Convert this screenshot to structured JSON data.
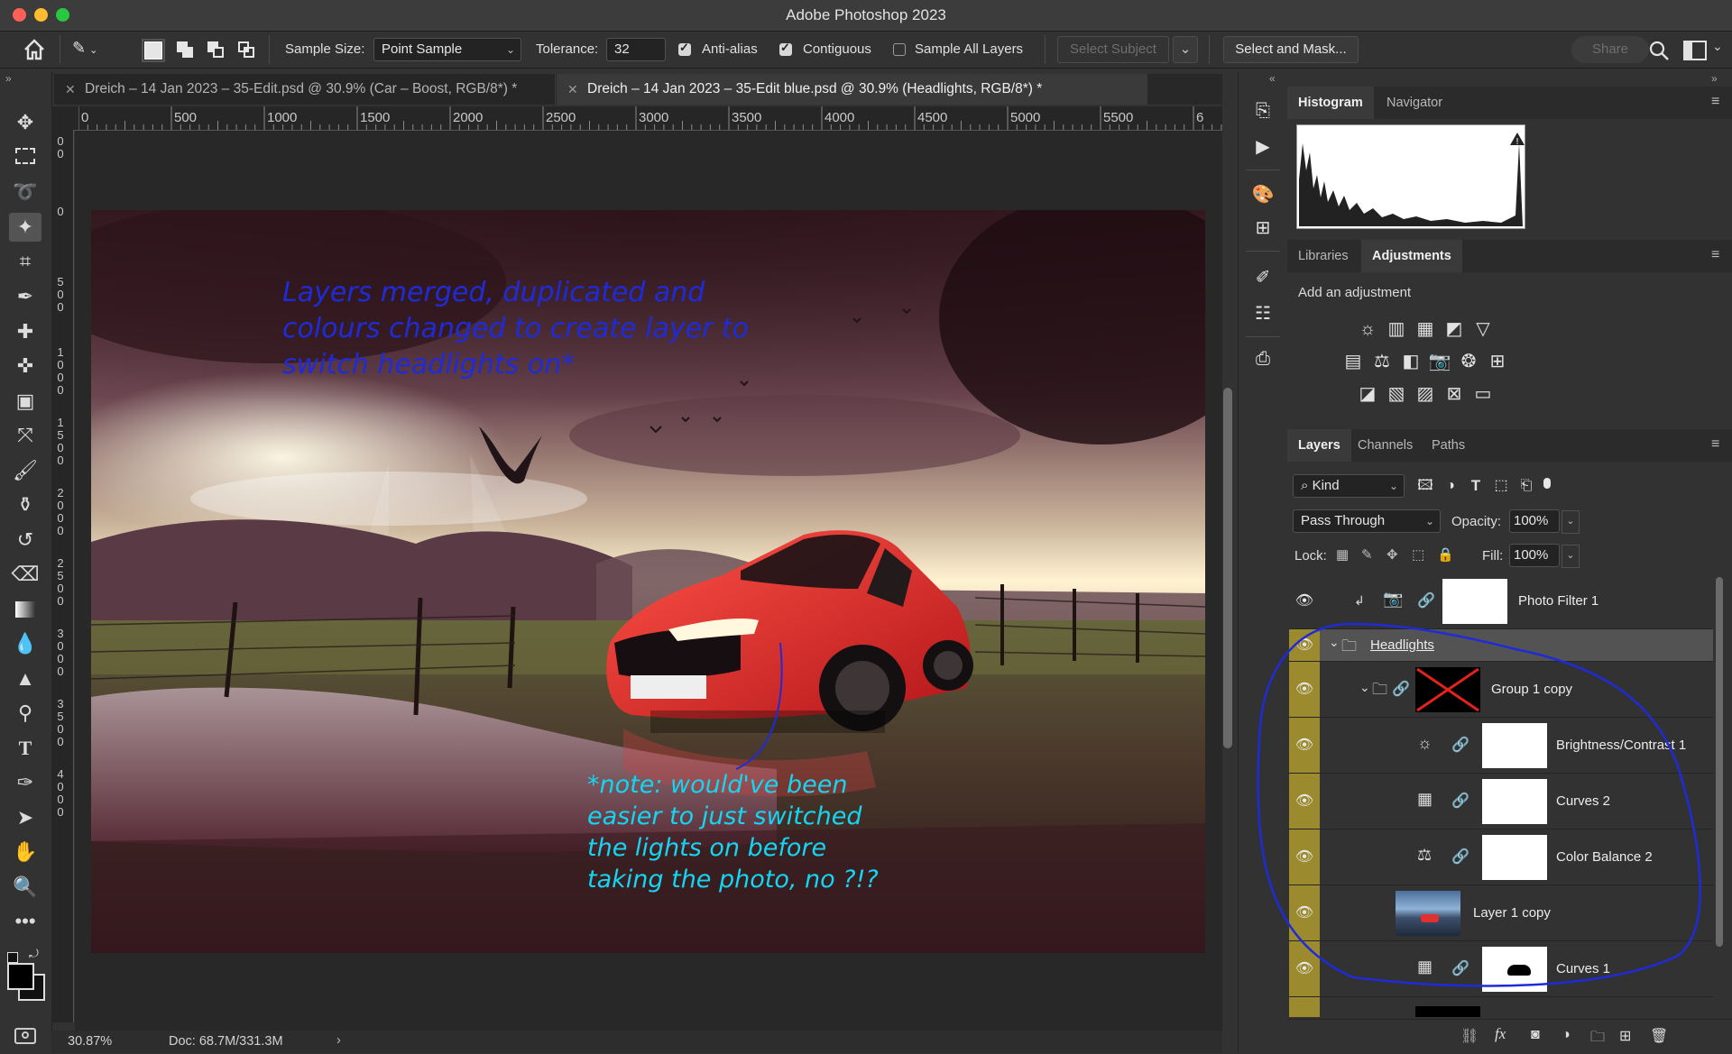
{
  "window": {
    "title": "Adobe Photoshop 2023"
  },
  "options_bar": {
    "sample_size_label": "Sample Size:",
    "sample_size_value": "Point Sample",
    "tolerance_label": "Tolerance:",
    "tolerance_value": "32",
    "anti_alias_label": "Anti-alias",
    "contiguous_label": "Contiguous",
    "sample_all_layers_label": "Sample All Layers",
    "select_subject_label": "Select Subject",
    "select_and_mask_label": "Select and Mask...",
    "share_label": "Share",
    "anti_alias_checked": true,
    "contiguous_checked": true,
    "sample_all_layers_checked": false
  },
  "tabs": [
    {
      "label": "Dreich – 14 Jan 2023 – 35-Edit.psd @ 30.9% (Car – Boost, RGB/8*) *",
      "active": false
    },
    {
      "label": "Dreich – 14 Jan 2023 – 35-Edit blue.psd @ 30.9% (Headlights, RGB/8*) *",
      "active": true
    }
  ],
  "ruler_h": [
    "0",
    "500",
    "1000",
    "1500",
    "2000",
    "2500",
    "3000",
    "3500",
    "4000",
    "4500",
    "5000",
    "5500",
    "6"
  ],
  "ruler_v": [
    "0 0",
    "0",
    "5 0 0",
    "1 0 0 0",
    "1 5 0 0",
    "2 0 0 0",
    "2 5 0 0",
    "3 0 0 0",
    "3 5 0 0",
    "4 0 0 0"
  ],
  "annotations": {
    "blue_note": [
      "Layers merged, duplicated and",
      "colours changed to create layer to",
      "switch headlights on*"
    ],
    "cyan_note": [
      "*note: would've been",
      "easier to just switched",
      "the lights on before",
      "taking the photo, no ?!?"
    ]
  },
  "status": {
    "zoom": "30.87%",
    "doc": "Doc: 68.7M/331.3M"
  },
  "panels": {
    "top_tabs": [
      "Histogram",
      "Navigator"
    ],
    "mid_tabs": [
      "Libraries",
      "Adjustments"
    ],
    "add_adjustment": "Add an adjustment",
    "layer_tabs": [
      "Layers",
      "Channels",
      "Paths"
    ]
  },
  "layers_controls": {
    "kind_label": "Kind",
    "blend_mode": "Pass Through",
    "opacity_label": "Opacity:",
    "opacity_value": "100%",
    "lock_label": "Lock:",
    "fill_label": "Fill:",
    "fill_value": "100%"
  },
  "layers": [
    {
      "name": "Photo Filter 1",
      "type": "adjustment",
      "icon": "camera-filter-icon"
    },
    {
      "name": "Headlights",
      "type": "group"
    },
    {
      "name": "Group 1 copy",
      "type": "group"
    },
    {
      "name": "Brightness/Contrast 1",
      "type": "adjustment",
      "icon": "brightness-icon"
    },
    {
      "name": "Curves 2",
      "type": "adjustment",
      "icon": "curves-icon"
    },
    {
      "name": "Color Balance 2",
      "type": "adjustment",
      "icon": "color-balance-icon"
    },
    {
      "name": "Layer 1 copy",
      "type": "pixel"
    },
    {
      "name": "Curves 1",
      "type": "adjustment",
      "icon": "curves-icon"
    }
  ],
  "colors": {
    "annotation_blue": "#1f2bd8",
    "annotation_cyan": "#13d6f2",
    "group_highlight": "#9b8a2e",
    "car_red": "#e02a24"
  }
}
